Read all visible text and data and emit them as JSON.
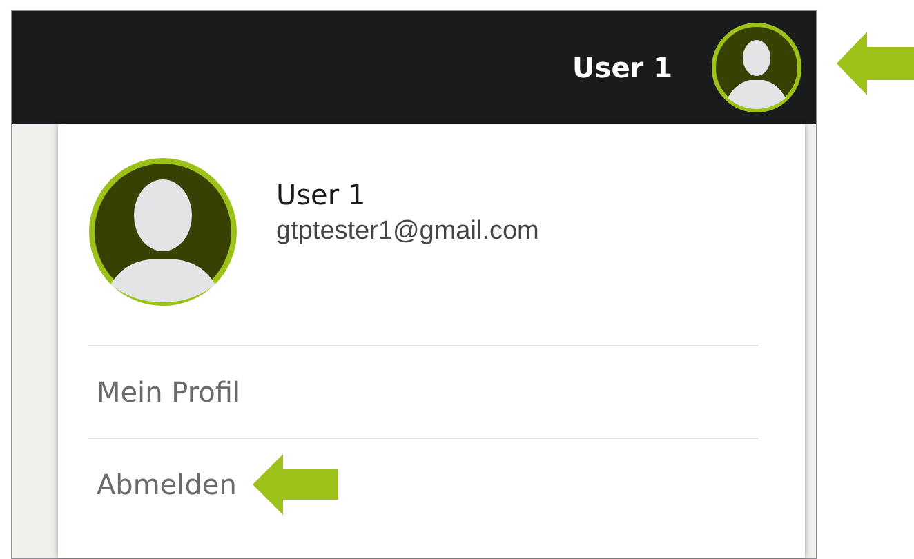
{
  "header": {
    "user_name": "User 1"
  },
  "dropdown": {
    "name": "User 1",
    "email": "gtptester1@gmail.com",
    "items": [
      {
        "label": "Mein Profil",
        "highlighted": false
      },
      {
        "label": "Abmelden",
        "highlighted": true
      }
    ]
  }
}
